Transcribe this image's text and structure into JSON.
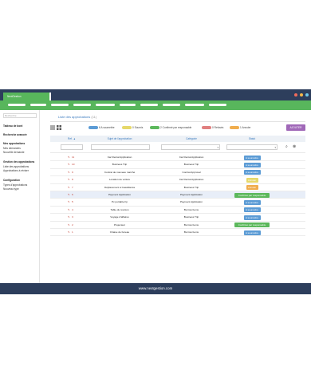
{
  "app": {
    "tab_label": "NextGestion"
  },
  "colors": {
    "chrome": "#2d3e5c",
    "brand_green": "#58b65c",
    "window_dots": [
      "#f26b5b",
      "#f5b84a",
      "#6ec7e9"
    ],
    "a_soumettre": "#5b9bd5",
    "soumis": "#e6d86a",
    "confirme": "#5cb85c",
    "refuses": "#e07f7f",
    "annuler": "#f0ad4e",
    "add_button": "#a068b8"
  },
  "sidebar": {
    "search_placeholder": "Recherche",
    "items": [
      {
        "label": "Tableau de bord",
        "heading": true
      },
      {
        "label": "Recherche avancée",
        "heading": true
      },
      {
        "label": "Mes approbations",
        "heading": true
      },
      {
        "label": "Mes demandes",
        "heading": false
      },
      {
        "label": "Nouvelle demande",
        "heading": false
      },
      {
        "label": "Gestion des approbations",
        "heading": true
      },
      {
        "label": "Liste des approbations",
        "heading": false
      },
      {
        "label": "Approbations à réviser",
        "heading": false
      },
      {
        "label": "Configuration",
        "heading": true
      },
      {
        "label": "Types d'approbations",
        "heading": false
      },
      {
        "label": "Nouveau type",
        "heading": false
      }
    ]
  },
  "main": {
    "title": "Liste des approbations",
    "count": "(11)",
    "add_button": "AJOUTER",
    "legend": [
      {
        "label": "6 A soumettre",
        "color": "#5b9bd5"
      },
      {
        "label": "0 Soumis",
        "color": "#e6d86a"
      },
      {
        "label": "2 Confirmé par responsable",
        "color": "#5cb85c"
      },
      {
        "label": "0 Refusés",
        "color": "#e07f7f"
      },
      {
        "label": "1 Annuler",
        "color": "#f0ad4e"
      }
    ]
  },
  "table": {
    "columns": [
      "Ref.",
      "Sujet de l'approbation",
      "Catégorie",
      "Statut"
    ],
    "sort_indicator": "▲",
    "rows": [
      {
        "ref": "11",
        "subject": "Car Rental Application",
        "category": "Car Rental Application",
        "status": "A soumettre",
        "status_color": "#5b9bd5",
        "selected": false
      },
      {
        "ref": "10",
        "subject": "Business Trip",
        "category": "Business Trip",
        "status": "A soumettre",
        "status_color": "#5b9bd5",
        "selected": false
      },
      {
        "ref": "9",
        "subject": "Contrat de nouveau marché",
        "category": "Contrat Approval",
        "status": "A soumettre",
        "status_color": "#5b9bd5",
        "selected": false
      },
      {
        "ref": "8",
        "subject": "Location de voiture",
        "category": "Car Rental Application",
        "status": "Annuler",
        "status_color": "#e6d86a",
        "selected": false
      },
      {
        "ref": "7",
        "subject": "Déplacement à Casablanca",
        "category": "Business Trip",
        "status": "Annuler",
        "status_color": "#f0ad4e",
        "selected": false
      },
      {
        "ref": "6",
        "subject": "Payment Application",
        "category": "Payment Application",
        "status": "Confirmé par responsable",
        "status_color": "#5cb85c",
        "selected": true
      },
      {
        "ref": "5",
        "subject": "Pc portable hp",
        "category": "Payment Application",
        "status": "A soumettre",
        "status_color": "#5b9bd5",
        "selected": false
      },
      {
        "ref": "4",
        "subject": "Table du réunion",
        "category": "Borrow Items",
        "status": "A soumettre",
        "status_color": "#5b9bd5",
        "selected": false
      },
      {
        "ref": "3",
        "subject": "Voyage d'affaires",
        "category": "Business Trip",
        "status": "A soumettre",
        "status_color": "#5b9bd5",
        "selected": false
      },
      {
        "ref": "2",
        "subject": "Projecteur",
        "category": "Borrow Items",
        "status": "Confirmé par responsable",
        "status_color": "#5cb85c",
        "selected": false
      },
      {
        "ref": "1",
        "subject": "Chaise de bureau",
        "category": "Borrow Items",
        "status": "A soumettre",
        "status_color": "#5b9bd5",
        "selected": false
      }
    ]
  },
  "footer": {
    "text": "www.nextgestion.com"
  }
}
